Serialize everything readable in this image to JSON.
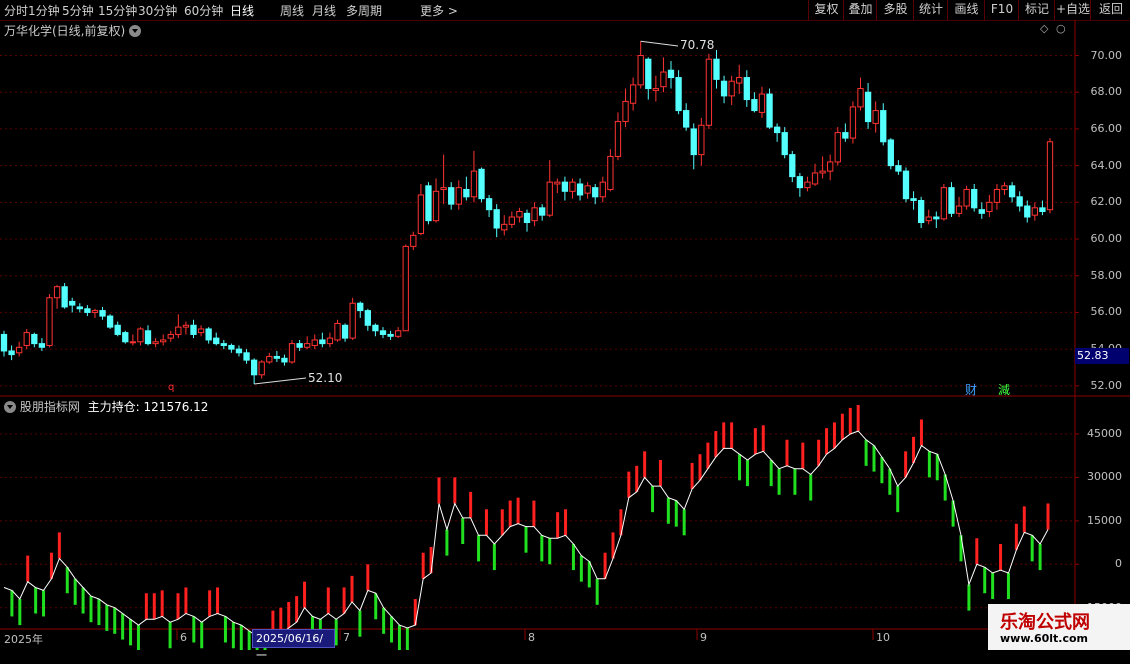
{
  "toolbar": {
    "periods": [
      "分时",
      "1分钟",
      "5分钟",
      "15分钟",
      "30分钟",
      "60分钟",
      "日线",
      "周线",
      "月线",
      "多周期",
      "更多 >"
    ],
    "active_period": "日线",
    "right_buttons": [
      "复权",
      "叠加",
      "多股",
      "统计",
      "画线",
      "F10",
      "标记",
      "+自选",
      "返回"
    ]
  },
  "main_panel": {
    "title": "万华化学(日线,前复权)",
    "high_label": "70.78",
    "low_label": "52.10",
    "current_price": "52.83",
    "y_ticks": [
      "70.00",
      "68.00",
      "66.00",
      "64.00",
      "62.00",
      "60.00",
      "58.00",
      "56.00",
      "54.00",
      "52.00"
    ],
    "markers": {
      "cai": "财",
      "jian": "減",
      "q": "q"
    }
  },
  "indicator_panel": {
    "title": "股朋指标网",
    "series_label": "主力持仓:",
    "series_value": "121576.12",
    "y_ticks": [
      "45000",
      "30000",
      "15000",
      "0",
      "-15000"
    ]
  },
  "x_axis": {
    "labels": [
      "2025年",
      "6",
      "7",
      "8",
      "9",
      "10"
    ],
    "cursor_date": "2025/06/16/一"
  },
  "watermark": {
    "name": "乐淘公式网",
    "url": "www.60lt.com"
  },
  "colors": {
    "up": "#ff3333",
    "down": "#54ffff",
    "grid": "#5a0000",
    "line": "#ffffff",
    "bar_red": "#ff2020",
    "bar_green": "#20e020"
  },
  "chart_data": {
    "type": "candlestick",
    "ylim": [
      51.5,
      71.5
    ],
    "candles": [
      [
        54.8,
        53.9,
        55.0,
        53.6
      ],
      [
        53.9,
        53.7,
        54.2,
        53.4
      ],
      [
        53.8,
        54.1,
        54.4,
        53.6
      ],
      [
        54.2,
        54.9,
        55.1,
        54.0
      ],
      [
        54.8,
        54.3,
        54.9,
        54.1
      ],
      [
        54.3,
        54.1,
        54.6,
        53.9
      ],
      [
        54.2,
        56.8,
        57.0,
        54.1
      ],
      [
        56.8,
        57.4,
        57.5,
        56.2
      ],
      [
        57.4,
        56.3,
        57.6,
        56.2
      ],
      [
        56.6,
        56.4,
        56.8,
        56.0
      ],
      [
        56.3,
        56.2,
        56.5,
        56.0
      ],
      [
        56.2,
        56.0,
        56.4,
        55.8
      ],
      [
        56.0,
        56.1,
        56.2,
        55.7
      ],
      [
        56.1,
        55.8,
        56.3,
        55.6
      ],
      [
        55.8,
        55.2,
        55.9,
        55.1
      ],
      [
        55.3,
        54.8,
        55.5,
        54.7
      ],
      [
        54.9,
        54.4,
        55.0,
        54.3
      ],
      [
        54.4,
        54.4,
        54.8,
        54.2
      ],
      [
        54.4,
        55.1,
        55.2,
        54.2
      ],
      [
        55.0,
        54.3,
        55.3,
        54.2
      ],
      [
        54.3,
        54.4,
        54.6,
        54.1
      ],
      [
        54.4,
        54.5,
        54.8,
        54.2
      ],
      [
        54.6,
        54.8,
        55.0,
        54.4
      ],
      [
        54.8,
        55.2,
        55.9,
        54.6
      ],
      [
        55.2,
        55.3,
        55.5,
        54.8
      ],
      [
        55.3,
        54.8,
        55.6,
        54.6
      ],
      [
        54.9,
        55.1,
        55.3,
        54.7
      ],
      [
        55.1,
        54.5,
        55.2,
        54.3
      ],
      [
        54.6,
        54.3,
        54.9,
        54.2
      ],
      [
        54.3,
        54.2,
        54.5,
        54.0
      ],
      [
        54.2,
        54.0,
        54.3,
        53.8
      ],
      [
        54.0,
        53.8,
        54.2,
        53.6
      ],
      [
        53.8,
        53.4,
        54.0,
        53.2
      ],
      [
        53.4,
        52.6,
        53.5,
        52.1
      ],
      [
        52.6,
        53.3,
        53.4,
        52.4
      ],
      [
        53.3,
        53.6,
        53.8,
        53.2
      ],
      [
        53.6,
        53.5,
        53.9,
        53.3
      ],
      [
        53.5,
        53.3,
        53.7,
        53.1
      ],
      [
        53.3,
        54.3,
        54.5,
        53.2
      ],
      [
        54.3,
        54.1,
        54.5,
        53.9
      ],
      [
        54.1,
        54.3,
        54.7,
        54.0
      ],
      [
        54.2,
        54.5,
        54.8,
        54.0
      ],
      [
        54.5,
        54.3,
        54.9,
        54.1
      ],
      [
        54.3,
        54.6,
        54.9,
        54.1
      ],
      [
        54.5,
        55.4,
        55.6,
        54.4
      ],
      [
        55.3,
        54.6,
        55.4,
        54.4
      ],
      [
        54.6,
        56.5,
        56.8,
        54.5
      ],
      [
        56.5,
        56.1,
        56.6,
        55.7
      ],
      [
        56.1,
        55.3,
        56.2,
        55.0
      ],
      [
        55.3,
        55.0,
        55.4,
        54.7
      ],
      [
        55.0,
        54.8,
        55.2,
        54.6
      ],
      [
        54.8,
        54.7,
        55.0,
        54.5
      ],
      [
        54.7,
        55.0,
        55.2,
        54.6
      ],
      [
        55.0,
        59.6,
        59.7,
        55.0
      ],
      [
        59.6,
        60.2,
        60.4,
        59.4
      ],
      [
        60.3,
        62.4,
        63.0,
        60.2
      ],
      [
        62.9,
        61.0,
        63.1,
        60.8
      ],
      [
        61.0,
        62.6,
        63.3,
        60.9
      ],
      [
        62.7,
        62.8,
        64.6,
        61.9
      ],
      [
        62.8,
        61.9,
        63.1,
        61.6
      ],
      [
        61.9,
        62.8,
        63.2,
        61.6
      ],
      [
        62.7,
        62.3,
        63.4,
        62.1
      ],
      [
        62.3,
        63.7,
        64.8,
        62.0
      ],
      [
        63.8,
        62.2,
        63.9,
        62.0
      ],
      [
        62.2,
        61.6,
        62.4,
        61.2
      ],
      [
        61.6,
        60.6,
        61.9,
        60.1
      ],
      [
        60.5,
        60.8,
        61.3,
        60.2
      ],
      [
        60.8,
        61.2,
        61.5,
        60.6
      ],
      [
        61.2,
        61.5,
        61.7,
        60.9
      ],
      [
        61.4,
        60.9,
        61.6,
        60.4
      ],
      [
        61.0,
        61.7,
        62.0,
        60.7
      ],
      [
        61.7,
        61.3,
        61.9,
        61.0
      ],
      [
        61.3,
        63.1,
        64.3,
        61.2
      ],
      [
        63.0,
        63.1,
        63.3,
        62.5
      ],
      [
        63.1,
        62.6,
        63.4,
        62.1
      ],
      [
        62.6,
        63.1,
        63.3,
        62.2
      ],
      [
        63.0,
        62.4,
        63.3,
        62.1
      ],
      [
        62.5,
        62.9,
        63.1,
        62.2
      ],
      [
        62.8,
        62.3,
        63.0,
        61.9
      ],
      [
        62.3,
        63.1,
        63.4,
        62.0
      ],
      [
        62.7,
        64.5,
        64.9,
        62.6
      ],
      [
        64.5,
        66.4,
        66.9,
        64.3
      ],
      [
        66.4,
        67.5,
        68.2,
        66.1
      ],
      [
        67.4,
        68.4,
        68.8,
        67.0
      ],
      [
        68.4,
        70.0,
        70.78,
        68.2
      ],
      [
        69.8,
        68.2,
        69.9,
        67.6
      ],
      [
        68.1,
        68.2,
        68.9,
        67.5
      ],
      [
        68.3,
        69.1,
        69.9,
        68.0
      ],
      [
        69.2,
        68.8,
        69.7,
        68.2
      ],
      [
        68.8,
        67.0,
        69.2,
        66.8
      ],
      [
        67.0,
        66.1,
        67.4,
        65.9
      ],
      [
        66.0,
        64.6,
        66.3,
        63.8
      ],
      [
        64.6,
        66.2,
        66.6,
        64.0
      ],
      [
        66.2,
        69.8,
        70.1,
        66.0
      ],
      [
        69.8,
        68.7,
        70.3,
        68.2
      ],
      [
        68.6,
        67.8,
        68.9,
        67.4
      ],
      [
        67.8,
        68.6,
        68.9,
        67.3
      ],
      [
        68.5,
        68.8,
        69.5,
        67.9
      ],
      [
        68.8,
        67.6,
        69.2,
        67.2
      ],
      [
        67.6,
        67.0,
        68.0,
        66.9
      ],
      [
        66.9,
        67.9,
        68.3,
        66.6
      ],
      [
        67.9,
        66.1,
        68.2,
        66.0
      ],
      [
        66.1,
        65.8,
        66.3,
        65.3
      ],
      [
        65.8,
        64.6,
        66.1,
        64.4
      ],
      [
        64.6,
        63.4,
        64.8,
        63.1
      ],
      [
        63.4,
        62.8,
        63.6,
        62.3
      ],
      [
        62.8,
        63.1,
        63.4,
        62.6
      ],
      [
        63.0,
        63.6,
        64.1,
        62.9
      ],
      [
        63.6,
        63.7,
        64.5,
        63.3
      ],
      [
        63.7,
        64.2,
        64.6,
        63.2
      ],
      [
        64.2,
        65.8,
        66.1,
        64.0
      ],
      [
        65.8,
        65.5,
        66.3,
        65.3
      ],
      [
        65.5,
        67.2,
        67.5,
        65.2
      ],
      [
        67.2,
        68.2,
        68.8,
        67.0
      ],
      [
        68.0,
        66.4,
        68.5,
        66.0
      ],
      [
        66.3,
        67.0,
        67.5,
        65.8
      ],
      [
        67.0,
        65.3,
        67.4,
        65.1
      ],
      [
        65.4,
        64.0,
        65.5,
        63.8
      ],
      [
        64.0,
        63.7,
        64.3,
        63.5
      ],
      [
        63.7,
        62.2,
        63.9,
        62.0
      ],
      [
        62.2,
        62.1,
        62.6,
        61.6
      ],
      [
        62.1,
        60.9,
        62.3,
        60.6
      ],
      [
        61.0,
        61.2,
        61.6,
        60.8
      ],
      [
        61.2,
        61.1,
        61.5,
        60.6
      ],
      [
        61.1,
        62.8,
        63.0,
        61.0
      ],
      [
        62.8,
        61.4,
        63.1,
        61.2
      ],
      [
        61.4,
        61.8,
        62.3,
        61.2
      ],
      [
        61.8,
        62.7,
        62.9,
        61.6
      ],
      [
        62.7,
        61.7,
        63.0,
        61.5
      ],
      [
        61.6,
        61.4,
        62.0,
        61.1
      ],
      [
        61.5,
        62.0,
        62.4,
        61.2
      ],
      [
        62.0,
        62.7,
        63.0,
        61.6
      ],
      [
        62.7,
        62.9,
        63.1,
        62.4
      ],
      [
        62.9,
        62.3,
        63.1,
        62.0
      ],
      [
        62.3,
        61.8,
        62.6,
        61.5
      ],
      [
        61.8,
        61.2,
        62.1,
        60.9
      ],
      [
        61.3,
        61.7,
        62.0,
        61.0
      ],
      [
        61.7,
        61.5,
        62.1,
        61.3
      ],
      [
        61.6,
        65.3,
        65.5,
        61.4
      ]
    ],
    "indicator": {
      "ylim": [
        -22000,
        55000
      ],
      "values": [
        -8000,
        -9000,
        -12000,
        -6000,
        -8000,
        -9000,
        -5000,
        2000,
        -1000,
        -5000,
        -8000,
        -11000,
        -12000,
        -14000,
        -15000,
        -17000,
        -19000,
        -21000,
        -19000,
        -19000,
        -18000,
        -20000,
        -19000,
        -17000,
        -18000,
        -20000,
        -18000,
        -17000,
        -18000,
        -20000,
        -21000,
        -23000,
        -25000,
        -27000,
        -25000,
        -24000,
        -22000,
        -20000,
        -15000,
        -18000,
        -19000,
        -17000,
        -19000,
        -17000,
        -13000,
        -16000,
        -9000,
        -10000,
        -15000,
        -18000,
        -21000,
        -22000,
        -21000,
        -5000,
        -3000,
        21000,
        12000,
        21000,
        16000,
        16000,
        10000,
        10000,
        7000,
        10000,
        13000,
        14000,
        13000,
        13000,
        10000,
        9000,
        9000,
        10000,
        7000,
        3000,
        1000,
        -5000,
        -5000,
        2000,
        10000,
        23000,
        25000,
        30000,
        27000,
        27000,
        23000,
        22000,
        19000,
        26000,
        29000,
        33000,
        37000,
        40000,
        40000,
        38000,
        36000,
        38000,
        39000,
        36000,
        33000,
        34000,
        33000,
        33000,
        31000,
        34000,
        38000,
        40000,
        43000,
        45000,
        46000,
        43000,
        41000,
        37000,
        33000,
        27000,
        30000,
        35000,
        41000,
        39000,
        38000,
        31000,
        22000,
        10000,
        -7000,
        0,
        -1000,
        -3000,
        -2000,
        -3000,
        5000,
        11000,
        10000,
        7000,
        12000
      ]
    }
  }
}
